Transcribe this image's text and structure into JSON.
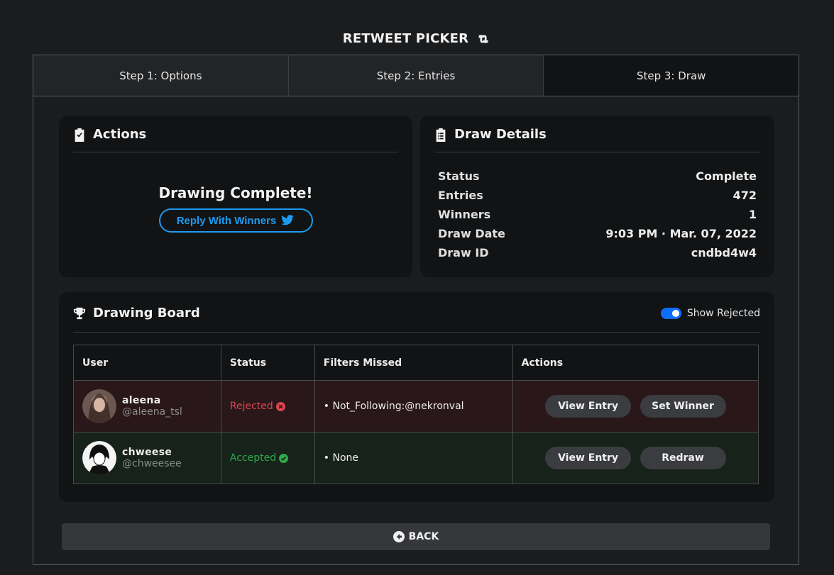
{
  "app": {
    "title": "RETWEET PICKER"
  },
  "tabs": [
    {
      "label": "Step 1: Options"
    },
    {
      "label": "Step 2: Entries"
    },
    {
      "label": "Step 3: Draw",
      "active": true
    }
  ],
  "actions": {
    "title": "Actions",
    "message": "Drawing Complete!",
    "reply_label": "Reply With Winners"
  },
  "draw_details": {
    "title": "Draw Details",
    "rows": [
      {
        "label": "Status",
        "value": "Complete"
      },
      {
        "label": "Entries",
        "value": "472"
      },
      {
        "label": "Winners",
        "value": "1"
      },
      {
        "label": "Draw Date",
        "value": "9:03 PM · Mar. 07, 2022"
      },
      {
        "label": "Draw ID",
        "value": "cndbd4w4"
      }
    ]
  },
  "board": {
    "title": "Drawing Board",
    "toggle_label": "Show Rejected",
    "toggle_on": true,
    "columns": [
      "User",
      "Status",
      "Filters Missed",
      "Actions"
    ],
    "rows": [
      {
        "name": "aleena",
        "handle": "@aleena_tsl",
        "status": "Rejected",
        "filter": "• Not_Following:@nekronval",
        "action1": "View Entry",
        "action2": "Set Winner"
      },
      {
        "name": "chweese",
        "handle": "@chweesee",
        "status": "Accepted",
        "filter": "• None",
        "action1": "View Entry",
        "action2": "Redraw"
      }
    ]
  },
  "footer": {
    "back_label": "BACK"
  },
  "colors": {
    "accent": "#1d9bf0",
    "rejected": "#e0444e",
    "accepted": "#2ea84a",
    "toggle": "#0d6efd"
  }
}
